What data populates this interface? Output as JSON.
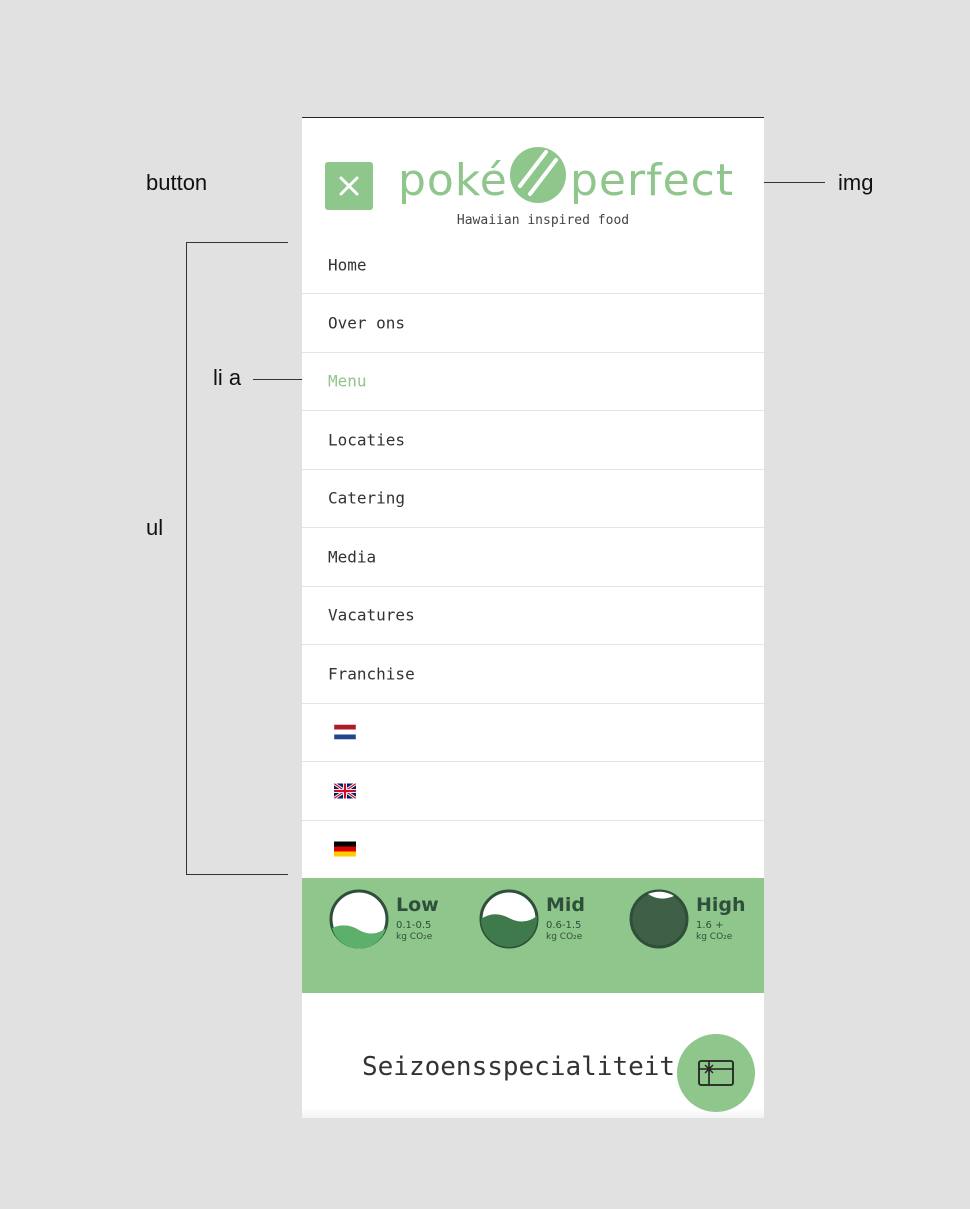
{
  "annotations": {
    "button": "button",
    "img": "img",
    "li_a": "li a",
    "ul": "ul"
  },
  "header": {
    "logo_text_left": "poké",
    "logo_text_right": "perfect",
    "tagline": "Hawaiian inspired food",
    "close_icon": "close-icon"
  },
  "nav": {
    "items": [
      {
        "label": "Home"
      },
      {
        "label": "Over ons"
      },
      {
        "label": "Menu",
        "active": true
      },
      {
        "label": "Locaties"
      },
      {
        "label": "Catering"
      },
      {
        "label": "Media"
      },
      {
        "label": "Vacatures"
      },
      {
        "label": "Franchise"
      }
    ],
    "flags": [
      "netherlands-flag-icon",
      "uk-flag-icon",
      "germany-flag-icon"
    ]
  },
  "co2": {
    "background": "#8fc68c",
    "items": [
      {
        "level": "Low",
        "range": "0.1-0.5",
        "unit": "kg CO₂e"
      },
      {
        "level": "Mid",
        "range": "0.6-1.5",
        "unit": "kg CO₂e"
      },
      {
        "level": "High",
        "range": "1.6 +",
        "unit": "kg CO₂e"
      }
    ]
  },
  "main": {
    "section_title": "Seizoensspecialiteit"
  },
  "fab": {
    "icon": "gift-card-icon"
  },
  "colors": {
    "accent": "#8fc68c",
    "text": "#333333",
    "dark_green": "#3f5f47"
  }
}
